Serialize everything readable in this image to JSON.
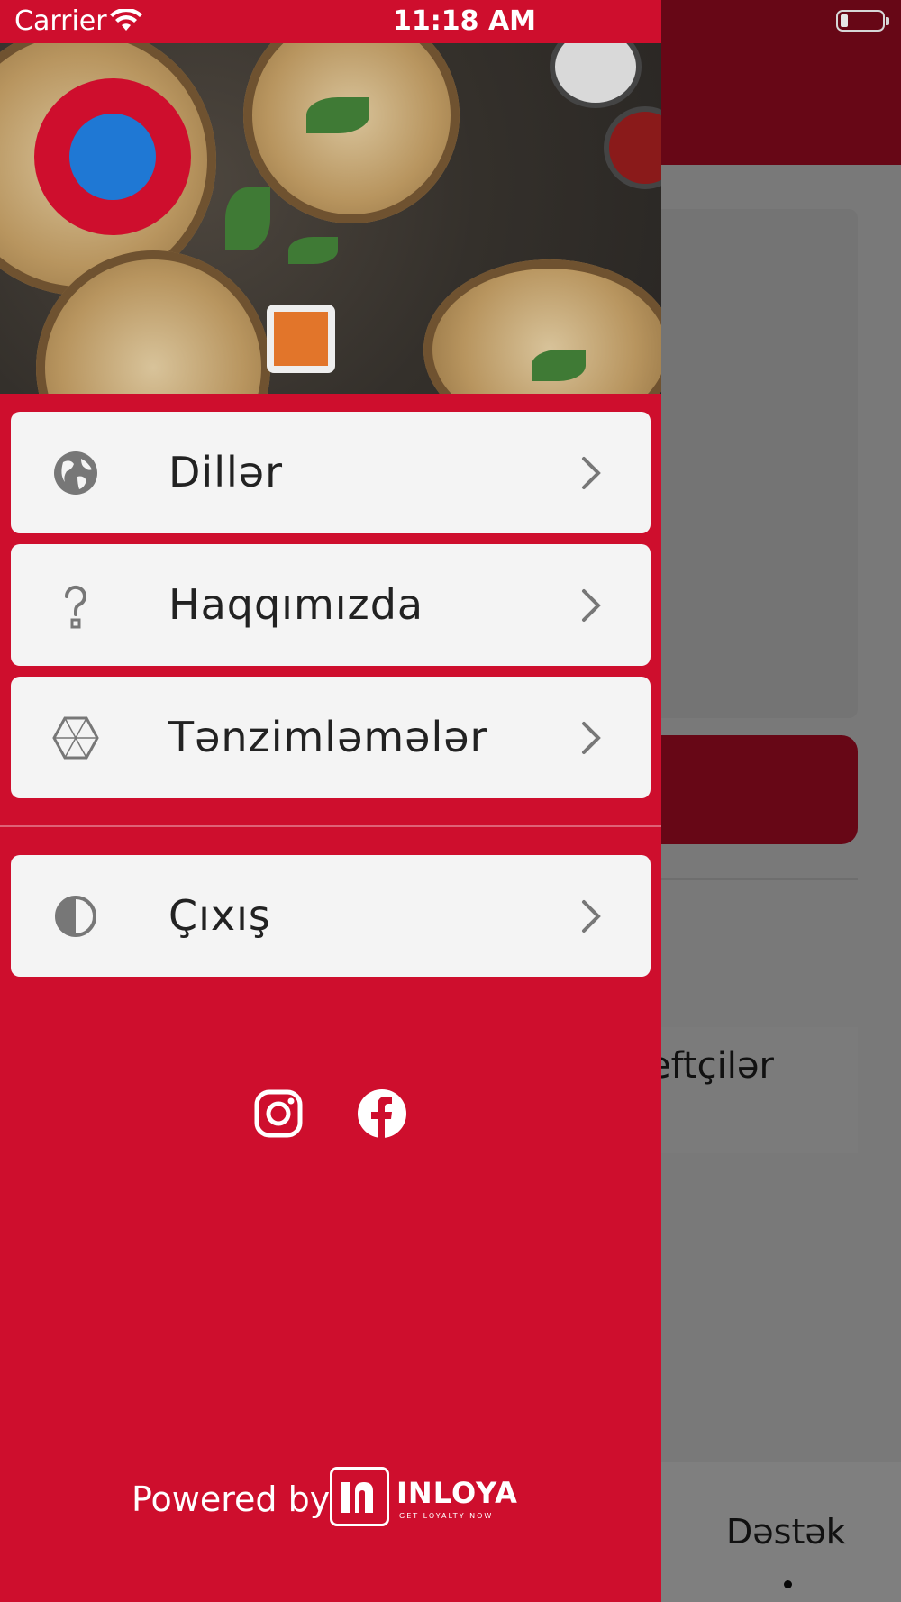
{
  "status_bar": {
    "carrier": "Carrier",
    "time": "11:18 AM"
  },
  "drawer": {
    "menu_items": [
      {
        "label": "Dillər",
        "icon": "globe-icon"
      },
      {
        "label": "Haqqımızda",
        "icon": "question-icon"
      },
      {
        "label": "Tənzimləmələr",
        "icon": "settings-icon"
      },
      {
        "label": "Çıxış",
        "icon": "logout-icon"
      }
    ],
    "social": [
      "instagram-icon",
      "facebook-icon"
    ],
    "footer": {
      "powered_by": "Powered by",
      "brand": "INLOYA",
      "tagline": "GET LOYALTY NOW"
    }
  },
  "background_app": {
    "partner_text": "eftçilər",
    "tab_label": "Dəstək"
  },
  "colors": {
    "brand_red": "#ce0e2d",
    "logo_blue": "#1f78d4",
    "menu_bg": "#f4f4f4"
  }
}
